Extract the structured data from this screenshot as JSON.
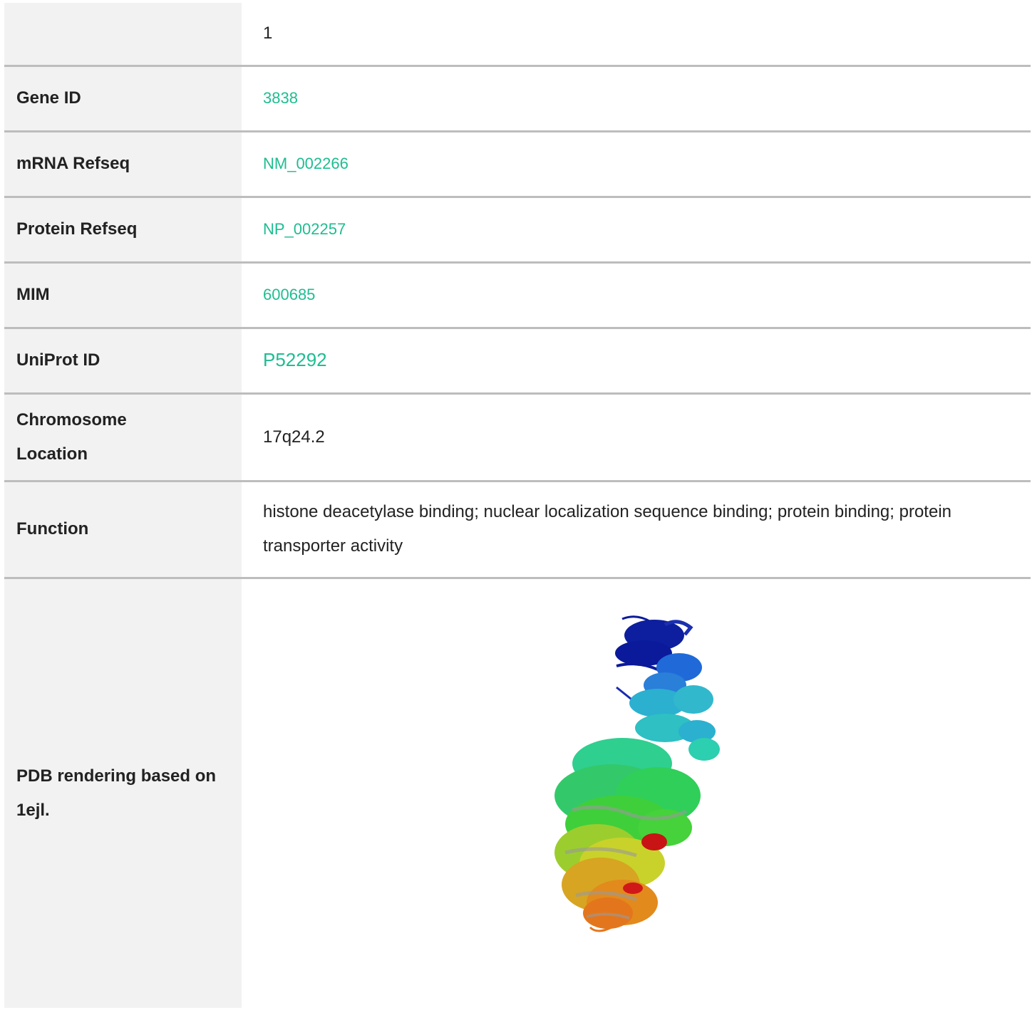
{
  "rows": [
    {
      "label": "",
      "value": "1",
      "type": "text"
    },
    {
      "label": "Gene ID",
      "value": "3838",
      "type": "link"
    },
    {
      "label": "mRNA Refseq",
      "value": "NM_002266",
      "type": "link"
    },
    {
      "label": "Protein Refseq",
      "value": "NP_002257",
      "type": "link"
    },
    {
      "label": "MIM",
      "value": "600685",
      "type": "link"
    },
    {
      "label": "UniProt ID",
      "value": "P52292",
      "type": "link"
    },
    {
      "label": "Chromosome Location",
      "value": "17q24.2",
      "type": "text"
    },
    {
      "label": "Function",
      "value": "histone deacetylase binding; nuclear localization sequence binding; protein binding; protein transporter activity",
      "type": "text"
    },
    {
      "label": "PDB rendering based on 1ejl.",
      "value": "",
      "type": "image"
    }
  ],
  "colors": {
    "label_bg": "#f2f2f2",
    "link": "#1ebd91",
    "divider": "#bdbdbd",
    "text": "#222222"
  },
  "pdb_image": {
    "icon": "protein-structure-rendering",
    "color_scale": [
      "#0a1a9a",
      "#1f6ad8",
      "#2bb0d0",
      "#2fcf8f",
      "#3fcf3a",
      "#c9d22a",
      "#e38a1c",
      "#c81414"
    ]
  }
}
